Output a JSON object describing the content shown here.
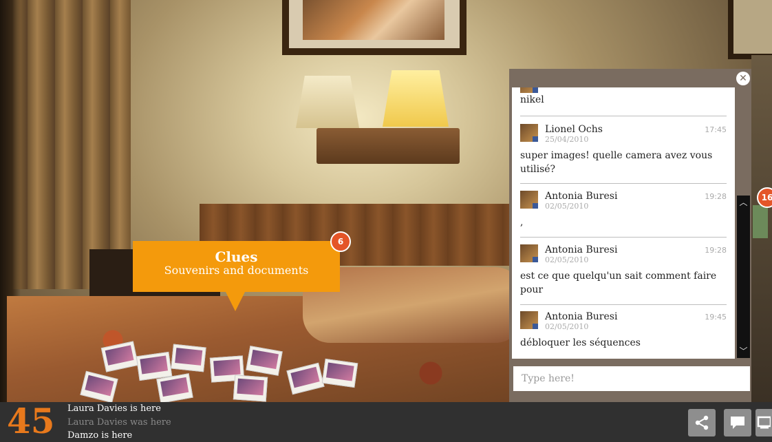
{
  "scene": {
    "clue": {
      "title": "Clues",
      "subtitle": "Souvenirs and documents",
      "count": "6"
    },
    "side_badge": "16"
  },
  "chat": {
    "close_icon": "close-icon",
    "messages": [
      {
        "name": "",
        "date": "",
        "time": "",
        "text": "nikel"
      },
      {
        "name": "Lionel Ochs",
        "date": "25/04/2010",
        "time": "17:45",
        "text": "super images! quelle camera avez vous utilisé?"
      },
      {
        "name": "Antonia Buresi",
        "date": "02/05/2010",
        "time": "19:28",
        "text": ","
      },
      {
        "name": "Antonia Buresi",
        "date": "02/05/2010",
        "time": "19:28",
        "text": "est ce que quelqu'un sait comment faire pour"
      },
      {
        "name": "Antonia Buresi",
        "date": "02/05/2010",
        "time": "19:45",
        "text": "débloquer les séquences"
      }
    ],
    "input_placeholder": "Type here!"
  },
  "bottom": {
    "count": "45",
    "presence": [
      "Laura Davies is here",
      "Laura Davies was here",
      "Damzo is here"
    ],
    "icons": [
      "share-icon",
      "comment-icon",
      "screen-icon"
    ]
  },
  "colors": {
    "clue_orange": "#f49a0c",
    "badge_red": "#e45528",
    "count_orange": "#e8791c",
    "panel": "#7a6c60"
  }
}
